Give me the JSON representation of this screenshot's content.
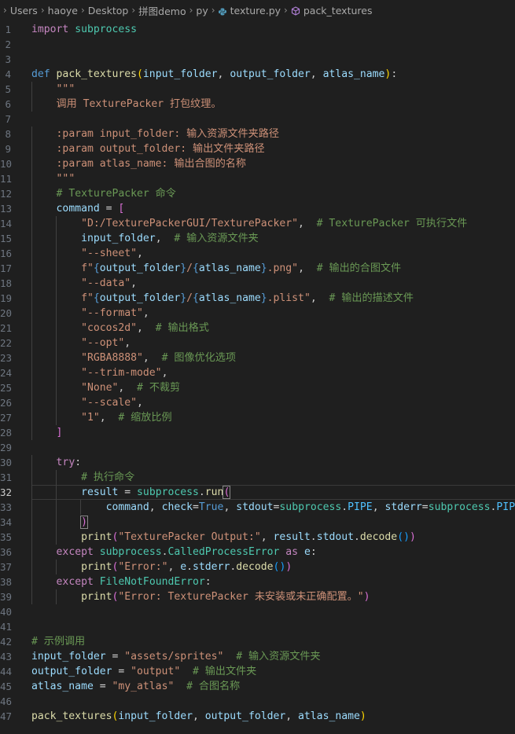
{
  "breadcrumb": {
    "items": [
      "Users",
      "haoye",
      "Desktop",
      "拼图demo",
      "py",
      "texture.py",
      "pack_textures"
    ]
  },
  "editor": {
    "current_line": 32,
    "lines": [
      [
        [
          "import",
          "kw"
        ],
        [
          " ",
          ""
        ],
        [
          "subprocess",
          "cls"
        ]
      ],
      [],
      [],
      [
        [
          "def",
          "def"
        ],
        [
          " ",
          ""
        ],
        [
          "pack_textures",
          "fn"
        ],
        [
          "(",
          "br1"
        ],
        [
          "input_folder",
          "var"
        ],
        [
          ", ",
          "punc"
        ],
        [
          "output_folder",
          "var"
        ],
        [
          ", ",
          "punc"
        ],
        [
          "atlas_name",
          "var"
        ],
        [
          ")",
          "br1"
        ],
        [
          ":",
          "punc"
        ]
      ],
      [
        [
          "    ",
          ""
        ],
        [
          "\"\"\"",
          "str"
        ]
      ],
      [
        [
          "    ",
          ""
        ],
        [
          "调用 TexturePacker 打包纹理。",
          "str"
        ]
      ],
      [],
      [
        [
          "    ",
          ""
        ],
        [
          ":param input_folder: 输入资源文件夹路径",
          "str"
        ]
      ],
      [
        [
          "    ",
          ""
        ],
        [
          ":param output_folder: 输出文件夹路径",
          "str"
        ]
      ],
      [
        [
          "    ",
          ""
        ],
        [
          ":param atlas_name: 输出合图的名称",
          "str"
        ]
      ],
      [
        [
          "    ",
          ""
        ],
        [
          "\"\"\"",
          "str"
        ]
      ],
      [
        [
          "    ",
          ""
        ],
        [
          "# TexturePacker 命令",
          "cm"
        ]
      ],
      [
        [
          "    ",
          ""
        ],
        [
          "command",
          "var"
        ],
        [
          " = ",
          "op"
        ],
        [
          "[",
          "br2"
        ]
      ],
      [
        [
          "        ",
          ""
        ],
        [
          "\"D:/TexturePackerGUI/TexturePacker\"",
          "str"
        ],
        [
          ",  ",
          "punc"
        ],
        [
          "# TexturePacker 可执行文件",
          "cm"
        ]
      ],
      [
        [
          "        ",
          ""
        ],
        [
          "input_folder",
          "var"
        ],
        [
          ",  ",
          "punc"
        ],
        [
          "# 输入资源文件夹",
          "cm"
        ]
      ],
      [
        [
          "        ",
          ""
        ],
        [
          "\"--sheet\"",
          "str"
        ],
        [
          ",",
          "punc"
        ]
      ],
      [
        [
          "        ",
          ""
        ],
        [
          "f\"",
          "str"
        ],
        [
          "{",
          "def"
        ],
        [
          "output_folder",
          "var"
        ],
        [
          "}",
          "def"
        ],
        [
          "/",
          "str"
        ],
        [
          "{",
          "def"
        ],
        [
          "atlas_name",
          "var"
        ],
        [
          "}",
          "def"
        ],
        [
          ".png\"",
          "str"
        ],
        [
          ",  ",
          "punc"
        ],
        [
          "# 输出的合图文件",
          "cm"
        ]
      ],
      [
        [
          "        ",
          ""
        ],
        [
          "\"--data\"",
          "str"
        ],
        [
          ",",
          "punc"
        ]
      ],
      [
        [
          "        ",
          ""
        ],
        [
          "f\"",
          "str"
        ],
        [
          "{",
          "def"
        ],
        [
          "output_folder",
          "var"
        ],
        [
          "}",
          "def"
        ],
        [
          "/",
          "str"
        ],
        [
          "{",
          "def"
        ],
        [
          "atlas_name",
          "var"
        ],
        [
          "}",
          "def"
        ],
        [
          ".plist\"",
          "str"
        ],
        [
          ",  ",
          "punc"
        ],
        [
          "# 输出的描述文件",
          "cm"
        ]
      ],
      [
        [
          "        ",
          ""
        ],
        [
          "\"--format\"",
          "str"
        ],
        [
          ",",
          "punc"
        ]
      ],
      [
        [
          "        ",
          ""
        ],
        [
          "\"cocos2d\"",
          "str"
        ],
        [
          ",  ",
          "punc"
        ],
        [
          "# 输出格式",
          "cm"
        ]
      ],
      [
        [
          "        ",
          ""
        ],
        [
          "\"--opt\"",
          "str"
        ],
        [
          ",",
          "punc"
        ]
      ],
      [
        [
          "        ",
          ""
        ],
        [
          "\"RGBA8888\"",
          "str"
        ],
        [
          ",  ",
          "punc"
        ],
        [
          "# 图像优化选项",
          "cm"
        ]
      ],
      [
        [
          "        ",
          ""
        ],
        [
          "\"--trim-mode\"",
          "str"
        ],
        [
          ",",
          "punc"
        ]
      ],
      [
        [
          "        ",
          ""
        ],
        [
          "\"None\"",
          "str"
        ],
        [
          ",  ",
          "punc"
        ],
        [
          "# 不裁剪",
          "cm"
        ]
      ],
      [
        [
          "        ",
          ""
        ],
        [
          "\"--scale\"",
          "str"
        ],
        [
          ",",
          "punc"
        ]
      ],
      [
        [
          "        ",
          ""
        ],
        [
          "\"1\"",
          "str"
        ],
        [
          ",  ",
          "punc"
        ],
        [
          "# 缩放比例",
          "cm"
        ]
      ],
      [
        [
          "    ",
          ""
        ],
        [
          "]",
          "br2"
        ]
      ],
      [],
      [
        [
          "    ",
          ""
        ],
        [
          "try",
          "kw"
        ],
        [
          ":",
          "punc"
        ]
      ],
      [
        [
          "        ",
          ""
        ],
        [
          "# 执行命令",
          "cm"
        ]
      ],
      [
        [
          "        ",
          ""
        ],
        [
          "result",
          "var"
        ],
        [
          " = ",
          "op"
        ],
        [
          "subprocess",
          "cls"
        ],
        [
          ".",
          "punc"
        ],
        [
          "run",
          "fn"
        ],
        [
          "(",
          "br2 br-match"
        ]
      ],
      [
        [
          "            ",
          ""
        ],
        [
          "command",
          "var"
        ],
        [
          ", ",
          "punc"
        ],
        [
          "check",
          "var"
        ],
        [
          "=",
          "op"
        ],
        [
          "True",
          "bool"
        ],
        [
          ", ",
          "punc"
        ],
        [
          "stdout",
          "var"
        ],
        [
          "=",
          "op"
        ],
        [
          "subprocess",
          "cls"
        ],
        [
          ".",
          "punc"
        ],
        [
          "PIPE",
          "const"
        ],
        [
          ", ",
          "punc"
        ],
        [
          "stderr",
          "var"
        ],
        [
          "=",
          "op"
        ],
        [
          "subprocess",
          "cls"
        ],
        [
          ".",
          "punc"
        ],
        [
          "PIPE",
          "const"
        ]
      ],
      [
        [
          "        ",
          ""
        ],
        [
          ")",
          "br2 br-match"
        ]
      ],
      [
        [
          "        ",
          ""
        ],
        [
          "print",
          "fn"
        ],
        [
          "(",
          "br2"
        ],
        [
          "\"TexturePacker Output:\"",
          "str"
        ],
        [
          ", ",
          "punc"
        ],
        [
          "result",
          "var"
        ],
        [
          ".",
          "punc"
        ],
        [
          "stdout",
          "var"
        ],
        [
          ".",
          "punc"
        ],
        [
          "decode",
          "fn"
        ],
        [
          "(",
          "br3"
        ],
        [
          ")",
          "br3"
        ],
        [
          ")",
          "br2"
        ]
      ],
      [
        [
          "    ",
          ""
        ],
        [
          "except",
          "kw"
        ],
        [
          " ",
          ""
        ],
        [
          "subprocess",
          "cls"
        ],
        [
          ".",
          "punc"
        ],
        [
          "CalledProcessError",
          "cls"
        ],
        [
          " ",
          ""
        ],
        [
          "as",
          "kw"
        ],
        [
          " ",
          ""
        ],
        [
          "e",
          "var"
        ],
        [
          ":",
          "punc"
        ]
      ],
      [
        [
          "        ",
          ""
        ],
        [
          "print",
          "fn"
        ],
        [
          "(",
          "br2"
        ],
        [
          "\"Error:\"",
          "str"
        ],
        [
          ", ",
          "punc"
        ],
        [
          "e",
          "var"
        ],
        [
          ".",
          "punc"
        ],
        [
          "stderr",
          "var"
        ],
        [
          ".",
          "punc"
        ],
        [
          "decode",
          "fn"
        ],
        [
          "(",
          "br3"
        ],
        [
          ")",
          "br3"
        ],
        [
          ")",
          "br2"
        ]
      ],
      [
        [
          "    ",
          ""
        ],
        [
          "except",
          "kw"
        ],
        [
          " ",
          ""
        ],
        [
          "FileNotFoundError",
          "cls"
        ],
        [
          ":",
          "punc"
        ]
      ],
      [
        [
          "        ",
          ""
        ],
        [
          "print",
          "fn"
        ],
        [
          "(",
          "br2"
        ],
        [
          "\"Error: TexturePacker 未安装或未正确配置。\"",
          "str"
        ],
        [
          ")",
          "br2"
        ]
      ],
      [],
      [],
      [
        [
          "# 示例调用",
          "cm"
        ]
      ],
      [
        [
          "input_folder",
          "var"
        ],
        [
          " = ",
          "op"
        ],
        [
          "\"assets/sprites\"",
          "str"
        ],
        [
          "  ",
          ""
        ],
        [
          "# 输入资源文件夹",
          "cm"
        ]
      ],
      [
        [
          "output_folder",
          "var"
        ],
        [
          " = ",
          "op"
        ],
        [
          "\"output\"",
          "str"
        ],
        [
          "  ",
          ""
        ],
        [
          "# 输出文件夹",
          "cm"
        ]
      ],
      [
        [
          "atlas_name",
          "var"
        ],
        [
          " = ",
          "op"
        ],
        [
          "\"my_atlas\"",
          "str"
        ],
        [
          "  ",
          ""
        ],
        [
          "# 合图名称",
          "cm"
        ]
      ],
      [],
      [
        [
          "pack_textures",
          "fn"
        ],
        [
          "(",
          "br1"
        ],
        [
          "input_folder",
          "var"
        ],
        [
          ", ",
          "punc"
        ],
        [
          "output_folder",
          "var"
        ],
        [
          ", ",
          "punc"
        ],
        [
          "atlas_name",
          "var"
        ],
        [
          ")",
          "br1"
        ]
      ]
    ]
  }
}
